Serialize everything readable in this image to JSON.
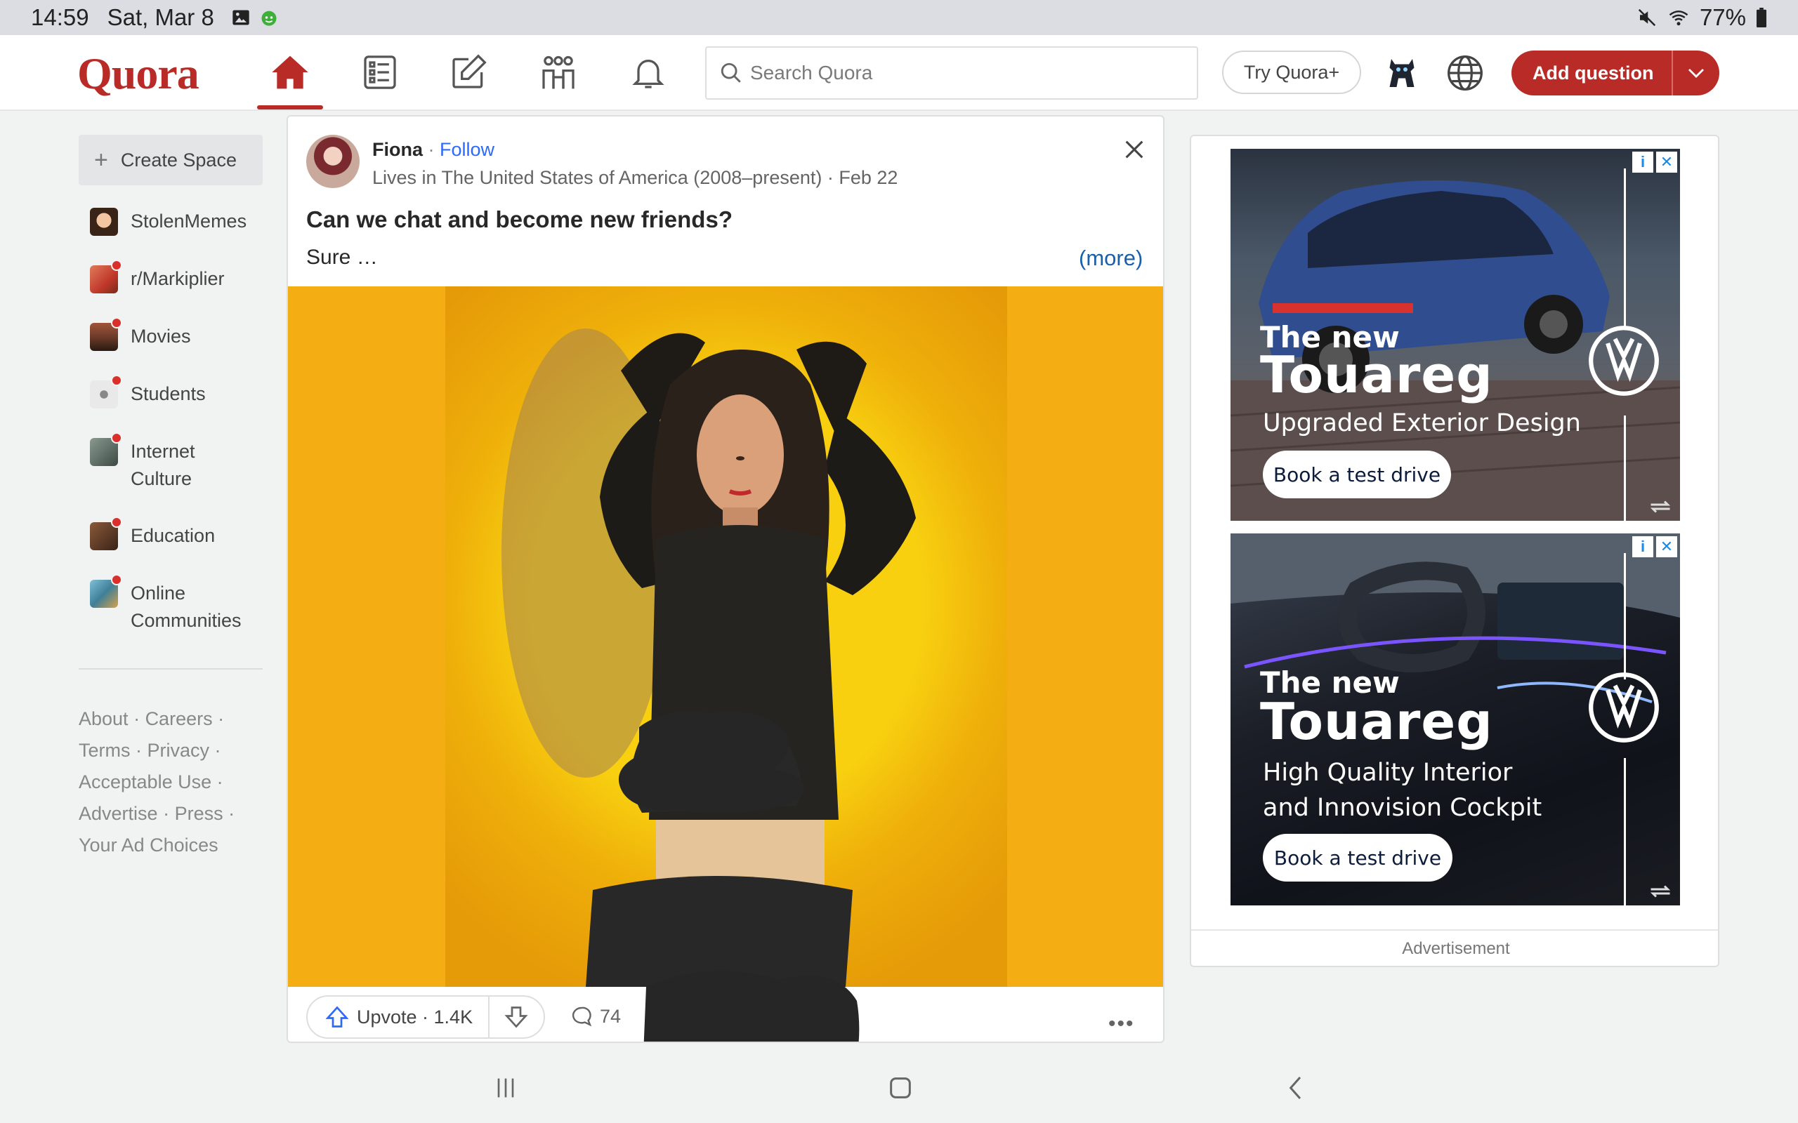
{
  "status_bar": {
    "time": "14:59",
    "date": "Sat, Mar 8",
    "battery": "77%"
  },
  "header": {
    "logo": "Quora",
    "search_placeholder": "Search Quora",
    "try_plus": "Try Quora+",
    "add_question": "Add question"
  },
  "sidebar": {
    "create_space": "Create Space",
    "items": [
      {
        "label": "StolenMemes",
        "badge": false,
        "color": "#8a5a3a"
      },
      {
        "label": "r/Markiplier",
        "badge": true,
        "color": "#c0392b"
      },
      {
        "label": "Movies",
        "badge": true,
        "color": "#6d3b2a"
      },
      {
        "label": "Students",
        "badge": true,
        "color": "#bfbfbf"
      },
      {
        "label": "Internet Culture",
        "badge": true,
        "color": "#5f6b66"
      },
      {
        "label": "Education",
        "badge": true,
        "color": "#5a3a2a"
      },
      {
        "label": "Online Communities",
        "badge": true,
        "color": "#4f8fa8"
      }
    ],
    "footer": {
      "about": "About",
      "careers": "Careers",
      "terms": "Terms",
      "privacy": "Privacy",
      "acceptable_use": "Acceptable Use",
      "advertise": "Advertise",
      "press": "Press",
      "ad_choices": "Your Ad Choices"
    }
  },
  "post": {
    "author": "Fiona",
    "follow": "Follow",
    "credential": "Lives in The United States of America (2008–present) · Feb 22",
    "question": "Can we chat and become new friends?",
    "snippet": "Sure …",
    "more": "(more)",
    "upvote_label": "Upvote · 1.4K",
    "comments": "74"
  },
  "ads": [
    {
      "line1": "The new",
      "model": "Touareg",
      "tagline1": "Upgraded Exterior Design",
      "tagline2": "",
      "cta": "Book a test drive"
    },
    {
      "line1": "The new",
      "model": "Touareg",
      "tagline1": "High Quality Interior",
      "tagline2": "and Innovision Cockpit",
      "cta": "Book a test drive"
    }
  ],
  "ad_label": "Advertisement",
  "colors": {
    "brand": "#b92b27",
    "link": "#2e69ff",
    "image_bg": "#f5ad14"
  }
}
